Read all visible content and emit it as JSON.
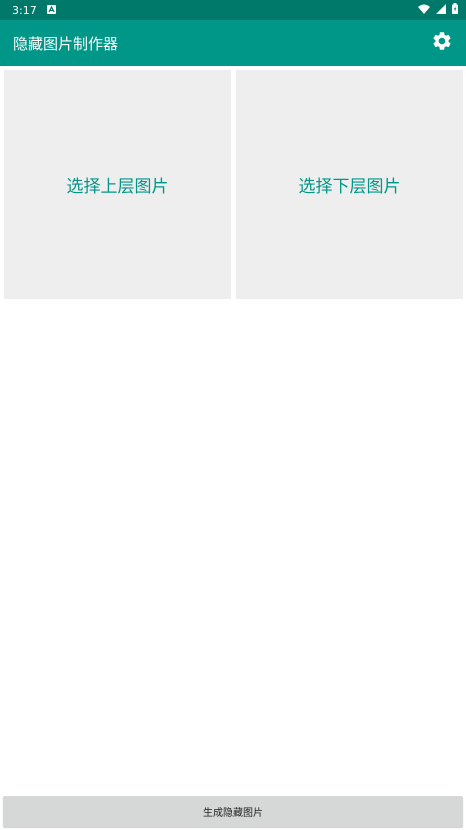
{
  "status_bar": {
    "time": "3:17",
    "icons": [
      "notification-a-icon",
      "wifi-icon",
      "signal-icon",
      "battery-icon"
    ]
  },
  "app_bar": {
    "title": "隐藏图片制作器",
    "settings_icon": "gear-icon"
  },
  "pickers": {
    "upper_label": "选择上层图片",
    "lower_label": "选择下层图片"
  },
  "actions": {
    "generate_label": "生成隐藏图片"
  },
  "colors": {
    "primary": "#009688",
    "primary_dark": "#00796b",
    "picker_bg": "#eeeeee",
    "button_bg": "#d6d7d7"
  }
}
